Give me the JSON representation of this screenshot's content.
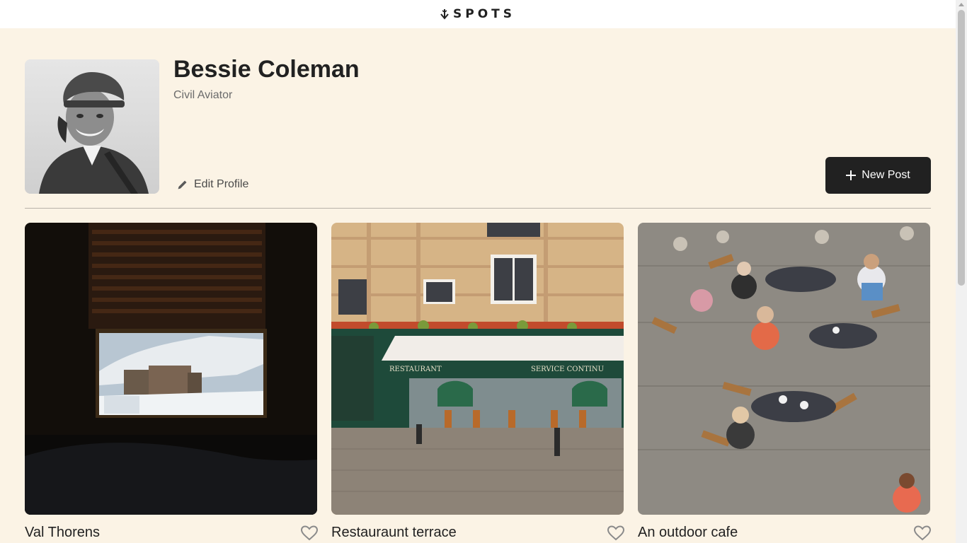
{
  "header": {
    "logo_text": "SPOTS"
  },
  "profile": {
    "name": "Bessie Coleman",
    "description": "Civil Aviator",
    "edit_label": "Edit Profile",
    "new_post_label": "New Post"
  },
  "cards": [
    {
      "title": "Val Thorens"
    },
    {
      "title": "Restauraunt terrace"
    },
    {
      "title": "An outdoor cafe"
    }
  ],
  "colors": {
    "background": "#fbf3e5",
    "header": "#ffffff",
    "button": "#212121",
    "text": "#212121",
    "muted": "#6b6b6b"
  }
}
